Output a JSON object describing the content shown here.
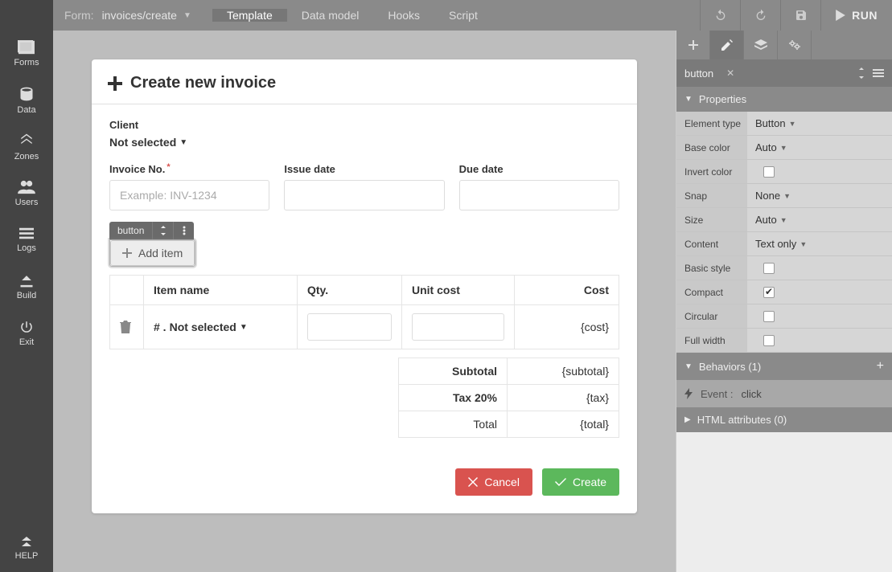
{
  "topbar": {
    "form_label": "Form:",
    "form_name": "invoices/create",
    "tabs": [
      "Template",
      "Data model",
      "Hooks",
      "Script"
    ],
    "active_tab": 0,
    "run_label": "RUN"
  },
  "sidebar": {
    "items": [
      {
        "key": "forms",
        "label": "Forms"
      },
      {
        "key": "data",
        "label": "Data"
      },
      {
        "key": "zones",
        "label": "Zones"
      },
      {
        "key": "users",
        "label": "Users"
      },
      {
        "key": "logs",
        "label": "Logs"
      },
      {
        "key": "build",
        "label": "Build"
      },
      {
        "key": "exit",
        "label": "Exit"
      }
    ],
    "help_label": "HELP"
  },
  "form": {
    "title": "Create new invoice",
    "client_label": "Client",
    "client_value": "Not selected",
    "invoice_no_label": "Invoice No.",
    "invoice_no_placeholder": "Example: INV-1234",
    "issue_date_label": "Issue date",
    "due_date_label": "Due date",
    "selected_badge": "button",
    "add_item_label": "Add item",
    "table": {
      "headers": {
        "name": "Item name",
        "qty": "Qty.",
        "unit": "Unit cost",
        "cost": "Cost"
      },
      "row": {
        "index": "# .",
        "name": "Not selected",
        "cost": "{cost}"
      }
    },
    "totals": {
      "subtotal_label": "Subtotal",
      "subtotal_value": "{subtotal}",
      "tax_label": "Tax 20%",
      "tax_value": "{tax}",
      "total_label": "Total",
      "total_value": "{total}"
    },
    "cancel_label": "Cancel",
    "create_label": "Create"
  },
  "panel": {
    "breadcrumb": "button",
    "sections": {
      "properties": "Properties",
      "behaviors": "Behaviors (1)",
      "html_attrs": "HTML attributes (0)"
    },
    "props": {
      "element_type": {
        "k": "Element type",
        "v": "Button"
      },
      "base_color": {
        "k": "Base color",
        "v": "Auto"
      },
      "invert_color": {
        "k": "Invert color"
      },
      "snap": {
        "k": "Snap",
        "v": "None"
      },
      "size": {
        "k": "Size",
        "v": "Auto"
      },
      "content": {
        "k": "Content",
        "v": "Text only"
      },
      "basic_style": {
        "k": "Basic style"
      },
      "compact": {
        "k": "Compact"
      },
      "circular": {
        "k": "Circular"
      },
      "full_width": {
        "k": "Full width"
      }
    },
    "event": {
      "label": "Event :",
      "value": "click"
    }
  }
}
